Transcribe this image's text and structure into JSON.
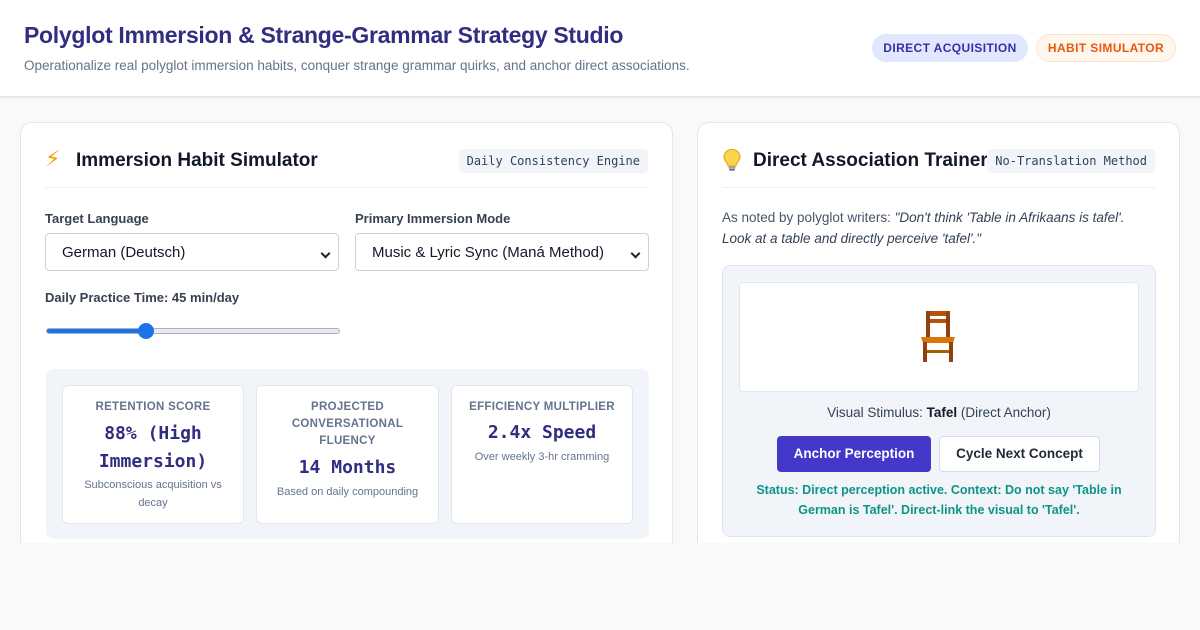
{
  "header": {
    "title": "Polyglot Immersion & Strange-Grammar Strategy Studio",
    "subtitle": "Operationalize real polyglot immersion habits, conquer strange grammar quirks, and anchor direct associations.",
    "badges": [
      "DIRECT ACQUISITION",
      "HABIT SIMULATOR"
    ]
  },
  "habit_card": {
    "icon": "lightning-bolt-icon",
    "title": "Immersion Habit Simulator",
    "tag": "Daily Consistency Engine",
    "target_language_label": "Target Language",
    "target_language_value": "German (Deutsch)",
    "immersion_mode_label": "Primary Immersion Mode",
    "immersion_mode_value": "Music & Lyric Sync (Maná Method)",
    "practice_time_label": "Daily Practice Time: 45 min/day",
    "practice_time_minutes": 45,
    "slider_fraction": 0.34,
    "stats": [
      {
        "label": "RETENTION SCORE",
        "value": "88% (High Immersion)",
        "note": "Subconscious acquisition vs decay"
      },
      {
        "label": "PROJECTED CONVERSATIONAL FLUENCY",
        "value": "14 Months",
        "note": "Based on daily compounding"
      },
      {
        "label": "EFFICIENCY MULTIPLIER",
        "value": "2.4x Speed",
        "note": "Over weekly 3-hr cramming"
      }
    ]
  },
  "trainer_card": {
    "icon": "lightbulb-icon",
    "title": "Direct Association Trainer",
    "tag": "No-Translation Method",
    "quote_intro": "As noted by polyglot writers: ",
    "quote": "\"Don't think 'Table in Afrikaans is tafel'. Look at a table and directly perceive 'tafel'.\"",
    "visual_icon": "chair-icon",
    "stimulus_prefix": "Visual Stimulus: ",
    "stimulus_word": "Tafel",
    "stimulus_suffix": " (Direct Anchor)",
    "anchor_button": "Anchor Perception",
    "next_button": "Cycle Next Concept",
    "status": "Status: Direct perception active. Context: Do not say 'Table in German is Tafel'. Direct-link the visual to 'Tafel'."
  },
  "colors": {
    "accent": "#4338ca",
    "title": "#312e81",
    "status": "#0d9488",
    "badge_orange": "#ea580c"
  }
}
